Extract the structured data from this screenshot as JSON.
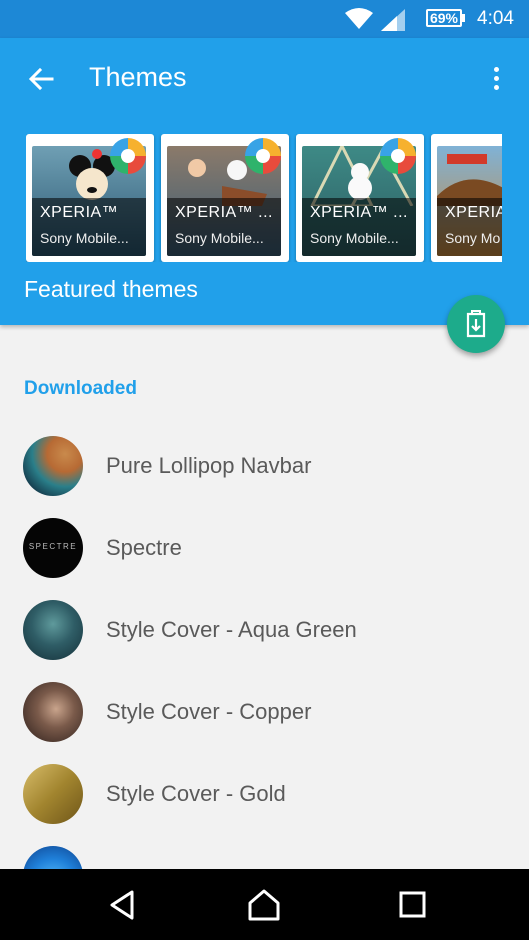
{
  "status_bar": {
    "battery": "69%",
    "time": "4:04"
  },
  "app_bar": {
    "title": "Themes",
    "featured_label": "Featured themes"
  },
  "featured": [
    {
      "brand": "XPERIA™",
      "author": "Sony Mobile...",
      "art": "mickey"
    },
    {
      "brand": "XPERIA™ ...",
      "author": "Sony Mobile...",
      "art": "frozen"
    },
    {
      "brand": "XPERIA™ ...",
      "author": "Sony Mobile...",
      "art": "frozen-olaf"
    },
    {
      "brand": "XPERIA",
      "author": "Sony Mo",
      "art": "cars"
    }
  ],
  "downloaded": {
    "header": "Downloaded",
    "items": [
      {
        "label": "Pure Lollipop Navbar",
        "art": "earth"
      },
      {
        "label": "Spectre",
        "art": "spectre",
        "art_text": "SPECTRE"
      },
      {
        "label": "Style Cover - Aqua Green",
        "art": "aqua"
      },
      {
        "label": "Style Cover - Copper",
        "art": "copper"
      },
      {
        "label": "Style Cover - Gold",
        "art": "gold"
      }
    ]
  },
  "colors": {
    "primary": "#21a0ea",
    "status_bar": "#1d88d6",
    "fab": "#1dab8b",
    "list_text": "#5a5a5a"
  },
  "icons": {
    "back": "arrow-left-icon",
    "overflow": "more-vert-icon",
    "fab": "download-theme-icon",
    "nav": [
      "back-triangle-icon",
      "home-icon",
      "recents-icon"
    ]
  }
}
